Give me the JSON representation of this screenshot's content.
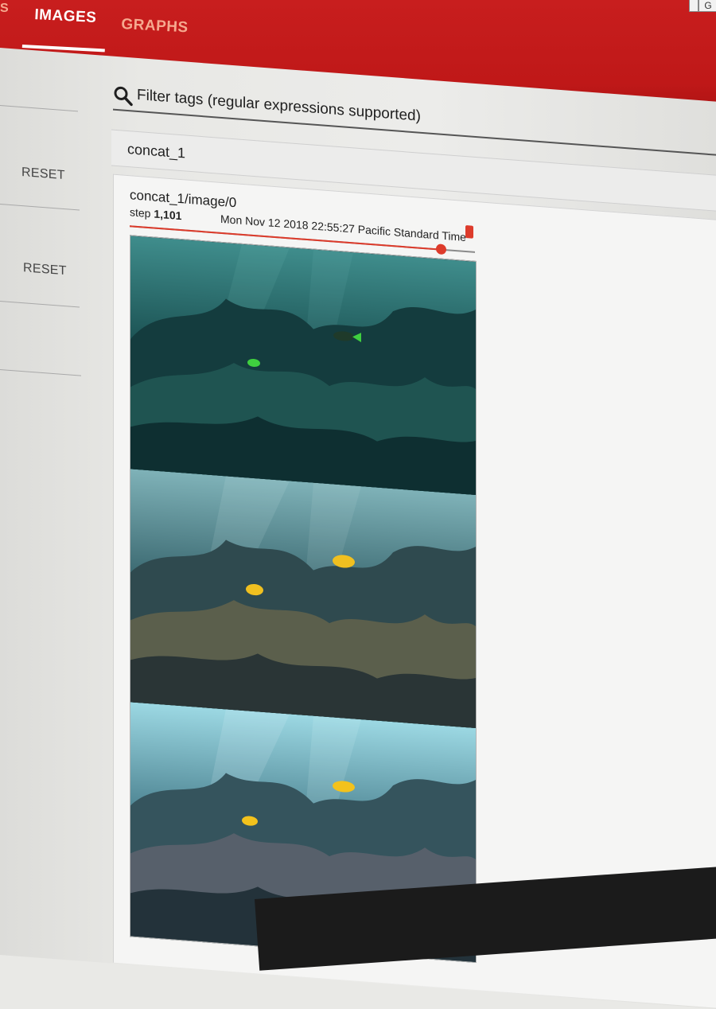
{
  "header": {
    "tabs": [
      {
        "label": "IMAGES",
        "active": true
      },
      {
        "label": "GRAPHS",
        "active": false
      }
    ],
    "left_partial_label": "S",
    "corner_glyph": "G"
  },
  "sidebar": {
    "reset_buttons": [
      "RESET",
      "RESET"
    ]
  },
  "filter": {
    "placeholder": "Filter tags (regular expressions supported)",
    "icon": "search-icon"
  },
  "tag_group": {
    "name": "concat_1"
  },
  "card": {
    "title": "concat_1/image/0",
    "step_prefix": "step",
    "step_value": "1,101",
    "timestamp": "Mon Nov 12 2018 22:55:27 Pacific Standard Time",
    "slider_fraction": 0.9
  },
  "colors": {
    "header_red": "#c81e1e",
    "accent_red": "#dd3b2b",
    "inactive_tab": "#f6a98f"
  },
  "image_panels": [
    {
      "name": "underwater-image-teal",
      "tint": "#0f3a3d",
      "fish_color": "#3fcf3f"
    },
    {
      "name": "underwater-image-mid",
      "tint": "#284a50",
      "fish_color": "#f0c020"
    },
    {
      "name": "underwater-image-bright",
      "tint": "#3b6b78",
      "fish_color": "#f3c21c"
    }
  ]
}
